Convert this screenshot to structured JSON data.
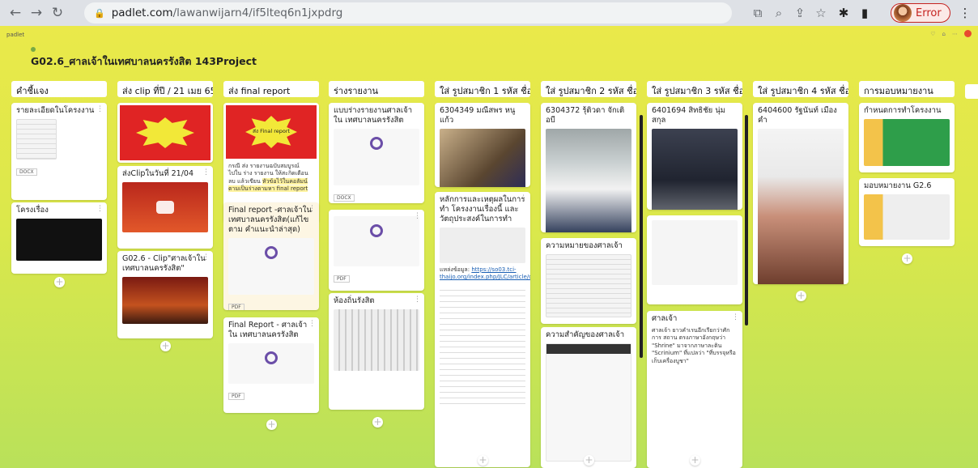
{
  "browser": {
    "url_domain": "padlet.com",
    "url_path": "/lawanwijarn4/if5lteq6n1jxpdrg",
    "profile_status": "Error"
  },
  "board": {
    "logo": "padlet",
    "title": "G02.6_ศาลเจ้าในเทศบาลนครรังสิต 143Project",
    "colors": {
      "bg_top": "#eae94a",
      "bg_bottom": "#b9e15a",
      "accent": "#e84a2f"
    }
  },
  "columns": [
    {
      "title": "คำชี้แจง"
    },
    {
      "title": "ส่ง clip ที่ปี / 21 เมย 65"
    },
    {
      "title": "ส่ง final report"
    },
    {
      "title": "ร่างรายงาน"
    },
    {
      "title": "ใส่ รูปสมาชิก 1 รหัส ชื่อ"
    },
    {
      "title": "ใส่ รูปสมาชิก 2 รหัส ชื่อ"
    },
    {
      "title": "ใส่ รูปสมาชิก 3 รหัส ชื่อ"
    },
    {
      "title": "ใส่ รูปสมาชิก 4 รหัส ชื่อ"
    },
    {
      "title": "การมอบหมายงาน"
    }
  ],
  "cards": {
    "c1a": {
      "title": "รายละเอียดในโครงงาน",
      "badge": "DOCX"
    },
    "c1b": {
      "title": "โครงเรื่อง"
    },
    "c2b": {
      "title": "ส่งClipในวันที่ 21/04"
    },
    "c2c": {
      "title": "G02.6 - Clip\"ศาลเจ้าใน เทศบาลนครรังสิต\""
    },
    "c3a": {
      "title": "ส่ง Final report",
      "body_pre": "กรณี ส่ง รายงานฉบับสมบูรณ์ ไปใน ร่าง รายงาน ให้สะกิดเตือนลบ แล้วเขียน",
      "body_hl": "หัวข้อไว้ในคอลัมน์ตามเป็นร่างตามหา final report"
    },
    "c3b": {
      "title": "Final report -ศาลเจ้าใน เทศบาลนครรังสิต(แก้ไขตาม คำแนะนำล่าสุด)",
      "badge": "PDF"
    },
    "c3c": {
      "title": "Final Report - ศาลเจ้าใน เทศบาลนครรังสิต",
      "badge": "PDF"
    },
    "c4a": {
      "title": "แบบร่างรายงานศาลเจ้าใน เทศบาลนครรังสิต",
      "badge": "DOCX"
    },
    "c4b": {
      "badge": "PDF"
    },
    "c4c": {
      "title": "ห้องถิ่นรังสิต"
    },
    "c5a": {
      "title": "6304349 มณีสพร หนูแก้ว"
    },
    "c5b": {
      "title": "หลักการและเหตุผลในการทำ โครงงานเรื่องนี้ และ วัตถุประสงค์ในการทำ",
      "link_label": "แหล่งข้อมูล:",
      "link": "https://so03.tci-thaijo.org/index.php/JLC/article/download/189764/132905/"
    },
    "c6a": {
      "title": "6304372 รุ้ติวดา จักเติอบี"
    },
    "c6b": {
      "title": "ความหมายของศาลเจ้า"
    },
    "c6c": {
      "title": "ความสำคัญของศาลเจ้า"
    },
    "c7a": {
      "title": "6401694 สิทธิชัย นุ่มสกุล"
    },
    "c7b": {
      "title": "ศาลเจ้า",
      "body": "ศาลเจ้า ยาวคำเรนอีกเรียกว่าศักการ สถาน ตรงภาษาอังกฤษว่า \"Shrine\" มาจากภาษาละติน \"Scrinium\" ที่แปลว่า \"ที่บรรจุหรือเก็บเครื่องบูชา\""
    },
    "c8a": {
      "title": "6404600 รัฐนันท์ เมืองคำ"
    },
    "c9a": {
      "title": "กำหนดการทำโครงงาน"
    },
    "c9b": {
      "title": "มอบหมายงาน G2.6"
    }
  }
}
